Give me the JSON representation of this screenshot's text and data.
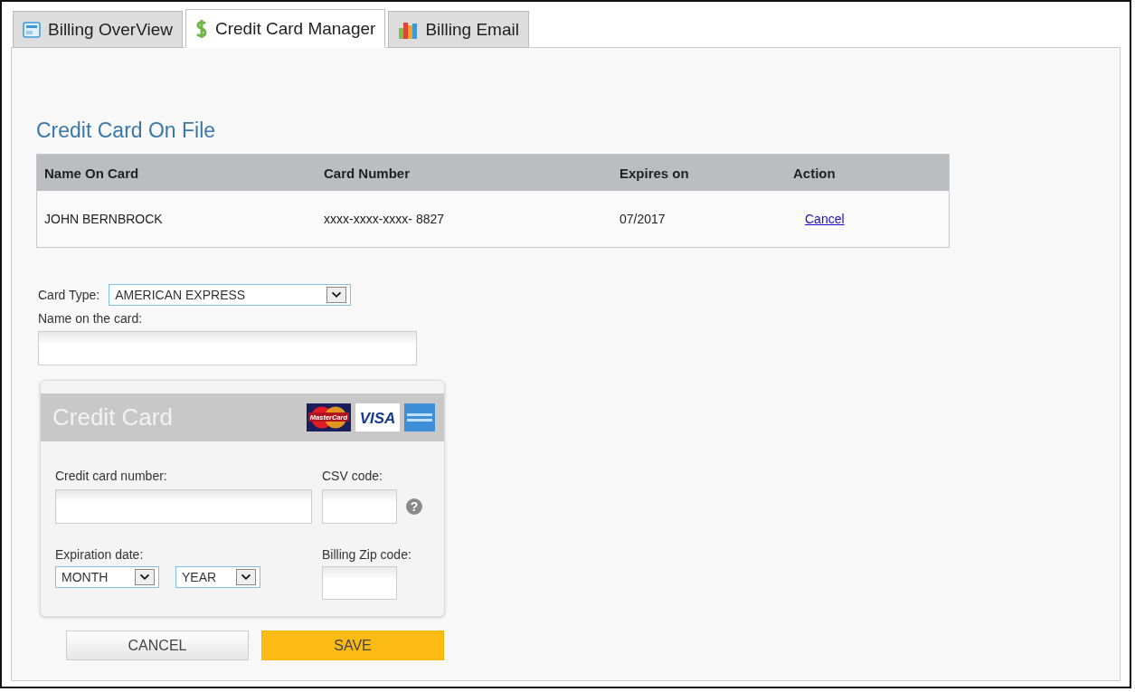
{
  "tabs": [
    {
      "label": "Billing OverView",
      "kind": "card",
      "selected": false
    },
    {
      "label": "Credit Card Manager",
      "kind": "dollar",
      "selected": true
    },
    {
      "label": "Billing Email",
      "kind": "chart",
      "selected": false
    }
  ],
  "on_file": {
    "title": "Credit Card On File",
    "columns": [
      "Name On Card",
      "Card Number",
      "Expires on",
      "Action"
    ],
    "rows": [
      {
        "name": "JOHN BERNBROCK",
        "number": "xxxx-xxxx-xxxx- 8827",
        "expires": "07/2017",
        "action": "Cancel"
      }
    ]
  },
  "card_type": {
    "label": "Card Type:",
    "value": "AMERICAN EXPRESS"
  },
  "name_field": {
    "label": "Name on the card:"
  },
  "card_panel": {
    "title": "Credit Card",
    "logos": [
      {
        "kind": "mastercard",
        "label": "MasterCard"
      },
      {
        "kind": "visa",
        "label": "VISA"
      },
      {
        "kind": "amex"
      }
    ],
    "number_label": "Credit card number:",
    "csv_label": "CSV code:",
    "help": "?",
    "expiry_label": "Expiration date:",
    "month": "MONTH",
    "year": "YEAR",
    "zip_label": "Billing Zip code:"
  },
  "buttons": [
    {
      "kind": "cancel",
      "label": "CANCEL"
    },
    {
      "kind": "save",
      "label": "SAVE"
    }
  ]
}
